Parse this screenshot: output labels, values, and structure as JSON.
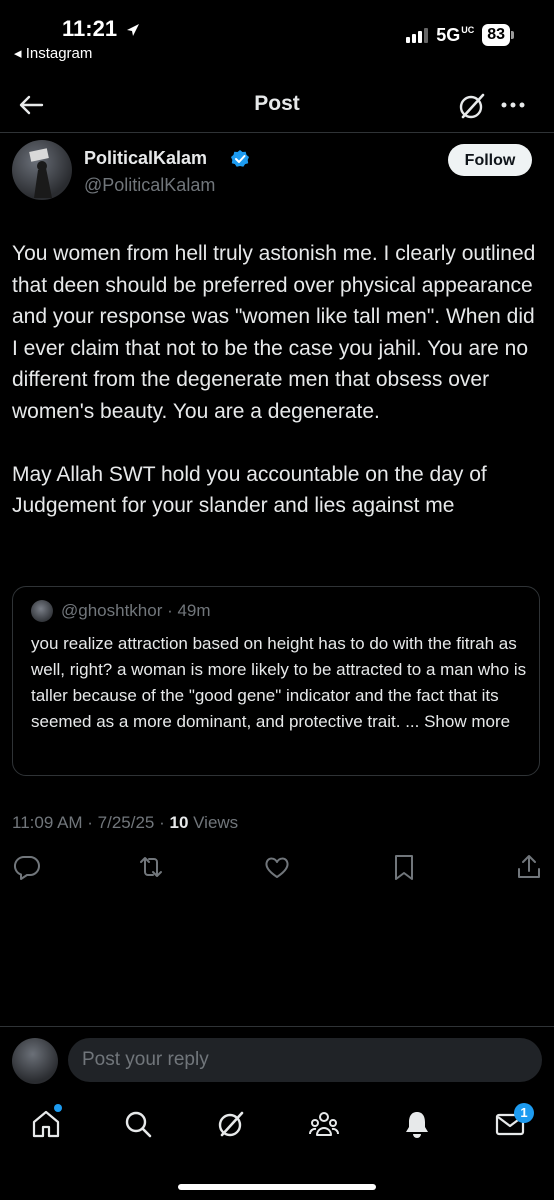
{
  "status_bar": {
    "time": "11:21",
    "back_app": "◂ Instagram",
    "network": "5G",
    "network_suffix": "UC",
    "battery": "83"
  },
  "header": {
    "title": "Post"
  },
  "author": {
    "display_name": "PoliticalKalam",
    "handle": "@PoliticalKalam",
    "follow_label": "Follow"
  },
  "tweet": {
    "text": "You women from hell truly astonish me. I clearly outlined that deen should be preferred over physical appearance and your response was \"women like tall men\". When did I ever claim that not to be the case you jahil. You are no different from the degenerate men that obsess over women's beauty. You are a degenerate.\n\nMay Allah SWT hold you accountable on the day of Judgement for your slander and lies against me"
  },
  "quoted": {
    "handle": "@ghoshtkhor · 49m",
    "text": "you realize attraction based on height has to do with the fitrah as well, right? a woman is more likely to be attracted to a man who is taller because of the \"good gene\" indicator and the fact that its seemed as a more dominant, and protective trait. ... Show more"
  },
  "meta": {
    "time_date": "11:09 AM · 7/25/25 · ",
    "views_count": "10",
    "views_label": " Views"
  },
  "reply": {
    "placeholder": "Post your reply"
  },
  "bottom_nav": {
    "messages_badge": "1"
  },
  "colors": {
    "background": "#000000",
    "text_primary": "#e7e9ea",
    "text_secondary": "#71767b",
    "accent": "#1d9bf0",
    "border": "#2f3336"
  }
}
